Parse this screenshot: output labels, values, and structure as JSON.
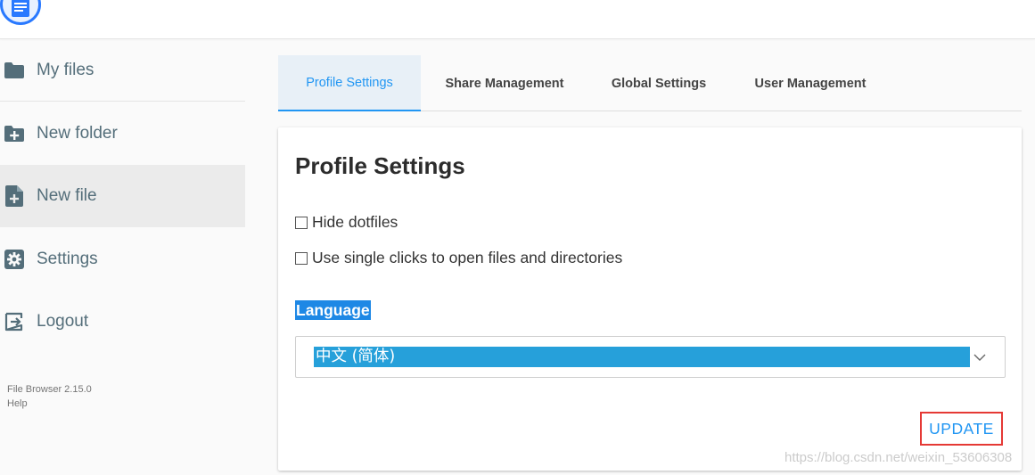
{
  "sidebar": {
    "items": [
      {
        "label": "My files",
        "icon": "folder-icon"
      },
      {
        "label": "New folder",
        "icon": "create-folder-icon"
      },
      {
        "label": "New file",
        "icon": "note-add-icon"
      },
      {
        "label": "Settings",
        "icon": "gear-icon"
      },
      {
        "label": "Logout",
        "icon": "logout-icon"
      }
    ],
    "credits": {
      "version": "File Browser 2.15.0",
      "help": "Help"
    }
  },
  "tabs": [
    {
      "label": "Profile Settings",
      "active": true
    },
    {
      "label": "Share Management",
      "active": false
    },
    {
      "label": "Global Settings",
      "active": false
    },
    {
      "label": "User Management",
      "active": false
    }
  ],
  "card": {
    "title": "Profile Settings",
    "options": [
      {
        "label": "Hide dotfiles",
        "checked": false
      },
      {
        "label": "Use single clicks to open files and directories",
        "checked": false
      }
    ],
    "language_label": "Language",
    "language_value": "中文 (简体)",
    "update_label": "UPDATE"
  },
  "watermark": "https://blog.csdn.net/weixin_53606308",
  "colors": {
    "accent": "#2196f3",
    "sidebar_text": "#546e7a",
    "highlight": "#26a0da",
    "annotation_red": "#e53935"
  }
}
